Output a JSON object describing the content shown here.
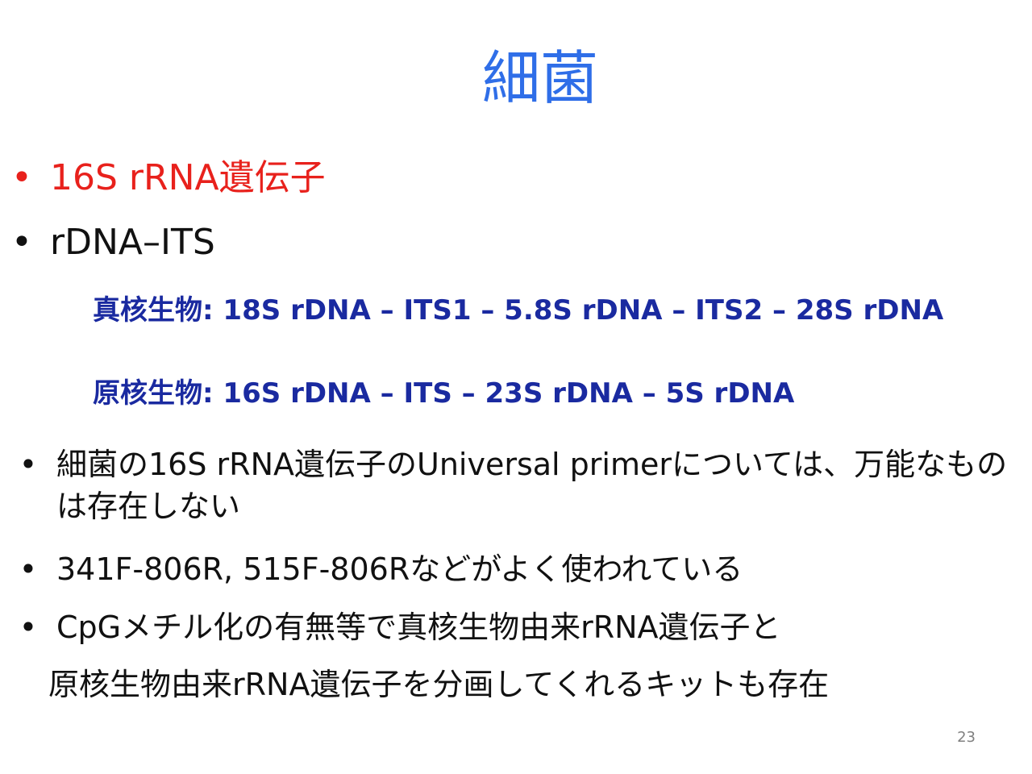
{
  "colors": {
    "title": "#2f6ee8",
    "highlight": "#e8211c",
    "sub_blue": "#1a2aa0",
    "body": "#111111",
    "page_number": "#7f7f7f"
  },
  "slide": {
    "title": "細菌",
    "bullets_top": [
      {
        "dot": "•",
        "text": "16S rRNA遺伝子"
      },
      {
        "dot": "•",
        "text": "rDNA–ITS"
      }
    ],
    "sub_lines": [
      "真核生物: 18S rDNA – ITS1 – 5.8S rDNA – ITS2 – 28S rDNA",
      "原核生物: 16S rDNA – ITS – 23S rDNA – 5S rDNA"
    ],
    "bullets_bottom": [
      {
        "dot": "•",
        "text": "細菌の16S rRNA遺伝子のUniversal primerについては、万能なものは存在しない"
      },
      {
        "dot": "•",
        "text": "341F-806R, 515F-806Rなどがよく使われている"
      },
      {
        "dot": "•",
        "text": "CpGメチル化の有無等で真核生物由来rRNA遺伝子と"
      }
    ],
    "continuation_line": "原核生物由来rRNA遺伝子を分画してくれるキットも存在",
    "page_number": "23"
  }
}
